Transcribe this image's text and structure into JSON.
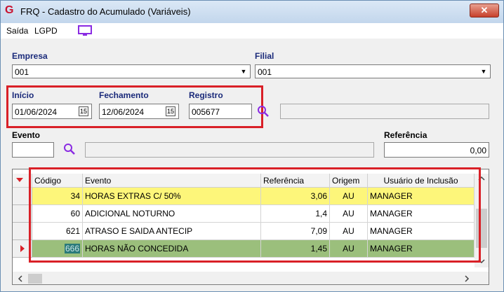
{
  "window": {
    "title": "FRQ - Cadastro do Acumulado (Variáveis)",
    "close_label": "✕"
  },
  "menu": {
    "saida": "Saída",
    "lgpd": "LGPD"
  },
  "empresa": {
    "label": "Empresa",
    "value": "001"
  },
  "filial": {
    "label": "Filial",
    "value": "001"
  },
  "inicio": {
    "label": "Início",
    "value": "01/06/2024",
    "cal": "15"
  },
  "fechamento": {
    "label": "Fechamento",
    "value": "12/06/2024",
    "cal": "15"
  },
  "registro": {
    "label": "Registro",
    "value": "005677",
    "desc": ""
  },
  "evento": {
    "label": "Evento",
    "value": "",
    "desc": ""
  },
  "referencia": {
    "label": "Referência",
    "value": "0,00"
  },
  "grid": {
    "columns": [
      "Código",
      "Evento",
      "Referência",
      "Origem",
      "Usuário de Inclusão"
    ],
    "rows": [
      {
        "codigo": "34",
        "evento": "HORAS EXTRAS C/ 50%",
        "referencia": "3,06",
        "origem": "AU",
        "usuario": "MANAGER"
      },
      {
        "codigo": "60",
        "evento": "ADICIONAL NOTURNO",
        "referencia": "1,4",
        "origem": "AU",
        "usuario": "MANAGER"
      },
      {
        "codigo": "621",
        "evento": "ATRASO E SAIDA ANTECIP",
        "referencia": "7,09",
        "origem": "AU",
        "usuario": "MANAGER"
      },
      {
        "codigo": "666",
        "evento": "HORAS NÃO CONCEDIDA",
        "referencia": "1,45",
        "origem": "AU",
        "usuario": "MANAGER"
      }
    ]
  },
  "colors": {
    "highlight_yellow": "#fdf67a",
    "highlight_green": "#9bbf7c",
    "selected_code_bg": "#2a7a7a",
    "annotation_red": "#d92027"
  }
}
